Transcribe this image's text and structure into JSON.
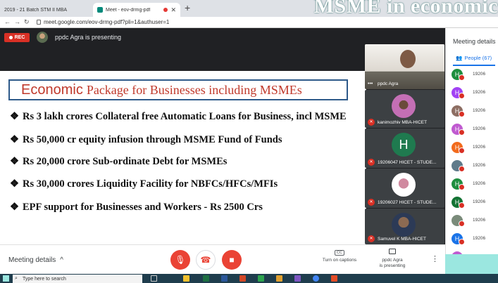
{
  "browser": {
    "tabs": [
      {
        "label": "2019 - 21 Batch STM II MBA"
      },
      {
        "label": "Meet - eov-drmg-pdf"
      }
    ],
    "new_tab": "+",
    "url": "meet.google.com/eov-drmg-pdf?pli=1&authuser=1"
  },
  "overlay_title": "MSME in economic",
  "meeting": {
    "rec_label": "REC",
    "presenter_banner": "ppdc Agra is presenting"
  },
  "slide": {
    "title_part1": "Economic",
    "title_part2": "Package for Businesses including MSMEs",
    "bullet_mark": "❖",
    "bullets": [
      "Rs 3 lakh crores Collateral free Automatic Loans  for Business, incl MSME",
      "Rs 50,000 cr equity infusion through MSME Fund  of Funds",
      "Rs 20,000 crore Sub-ordinate Debt for MSMEs",
      "Rs 30,000 crores Liquidity Facility for  NBFCs/HFCs/MFIs",
      "EPF support for Businesses and  Workers - Rs 2500 Crs"
    ]
  },
  "participants": [
    {
      "name": "ppdc Agra"
    },
    {
      "name": "kanimozhiv MBA-HICET"
    },
    {
      "name": "19206047 HICET - STUDE...",
      "initial": "H"
    },
    {
      "name": "19206027 HICET - STUDE..."
    },
    {
      "name": "Samuvel K MBA-HICET"
    }
  ],
  "panel": {
    "title": "Meeting details",
    "people_tab": "People (67)",
    "rows": [
      {
        "initial": "H",
        "id": "19206",
        "color": "#1e8e3e"
      },
      {
        "initial": "H",
        "id": "19206",
        "color": "#a142f4"
      },
      {
        "initial": "H",
        "id": "19206",
        "color": "#8d6e63"
      },
      {
        "initial": "H",
        "id": "19206",
        "color": "#c05ad0"
      },
      {
        "initial": "H",
        "id": "19206",
        "color": "#f26b1d"
      },
      {
        "initial": "",
        "id": "19206",
        "color": "#5f7a8a"
      },
      {
        "initial": "H",
        "id": "19206",
        "color": "#1e8e3e"
      },
      {
        "initial": "H",
        "id": "19206",
        "color": "#137333"
      },
      {
        "initial": "",
        "id": "19206",
        "color": "#7a8b7a"
      },
      {
        "initial": "H",
        "id": "19206",
        "color": "#1a73e8"
      },
      {
        "initial": "H",
        "id": "19206",
        "color": "#c05ad0"
      }
    ]
  },
  "bottom": {
    "meeting_details": "Meeting details",
    "captions_icon": "CC",
    "captions_label": "Turn on captions",
    "presenting_line1": "ppdc Agra",
    "presenting_line2": "is presenting",
    "more": "⋮"
  },
  "taskbar": {
    "search_placeholder": "Type here to search"
  },
  "icons": {
    "back": "arrow-left-icon",
    "forward": "arrow-right-icon",
    "reload": "reload-icon",
    "mic_off": "mic-off-icon",
    "hangup": "phone-hangup-icon",
    "cam_off": "camera-off-icon"
  }
}
